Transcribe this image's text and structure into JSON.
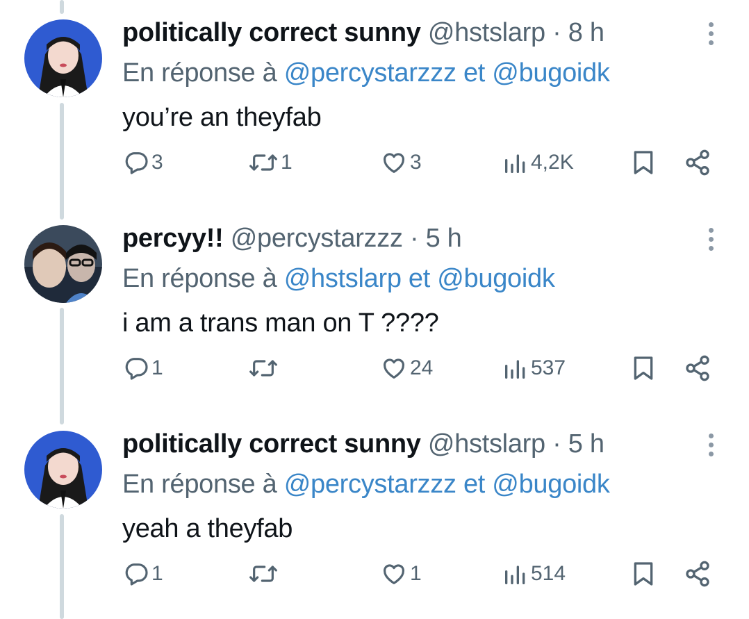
{
  "tweets": [
    {
      "name": "politically correct sunny",
      "handle": "@hstslarp",
      "separator": "·",
      "time": "8 h",
      "reply_prefix": "En réponse à",
      "reply_mention_1": "@percystarzzz",
      "reply_joiner": "et",
      "reply_mention_2": "@bugoidk",
      "text": "you’re an theyfab",
      "replies": "3",
      "retweets": "1",
      "likes": "3",
      "views": "4,2K"
    },
    {
      "name": "percyy!!",
      "handle": "@percystarzzz",
      "separator": "·",
      "time": "5 h",
      "reply_prefix": "En réponse à",
      "reply_mention_1": "@hstslarp",
      "reply_joiner": "et",
      "reply_mention_2": "@bugoidk",
      "text": "i am a trans man on T ????",
      "replies": "1",
      "retweets": "",
      "likes": "24",
      "views": "537"
    },
    {
      "name": "politically correct sunny",
      "handle": "@hstslarp",
      "separator": "·",
      "time": "5 h",
      "reply_prefix": "En réponse à",
      "reply_mention_1": "@percystarzzz",
      "reply_joiner": "et",
      "reply_mention_2": "@bugoidk",
      "text": "yeah a theyfab",
      "replies": "1",
      "retweets": "",
      "likes": "1",
      "views": "514"
    }
  ],
  "colors": {
    "text": "#0f1419",
    "secondary": "#536471",
    "mention": "#3a86c8",
    "thread_line": "#cfd9de"
  }
}
